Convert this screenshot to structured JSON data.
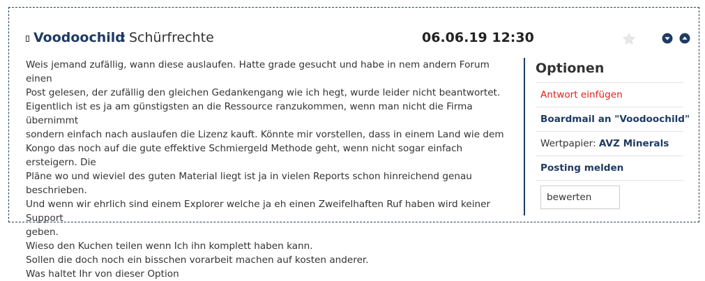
{
  "post": {
    "author": "Voodoochild",
    "separator": ":",
    "subject": "Schürfrechte",
    "datetime": "06.06.19 12:30",
    "icons": {
      "header": "document-icon",
      "favorite": "star-icon",
      "scroll_down": "chevron-down-icon",
      "scroll_up": "chevron-up-icon"
    },
    "body_lines": [
      "Weis jemand zufällig, wann diese auslaufen. Hatte grade gesucht und habe in nem andern Forum einen",
      "Post gelesen, der zufällig den gleichen Gedankengang wie ich hegt, wurde leider nicht beantwortet.",
      "Eigentlich ist es ja am günstigsten an die Ressource ranzukommen, wenn man nicht die Firma übernimmt",
      "sondern einfach nach auslaufen die Lizenz kauft. Könnte mir vorstellen, dass in einem Land wie dem",
      "Kongo das noch auf die gute effektive Schmiergeld Methode geht, wenn nicht sogar einfach ersteigern. Die",
      "Pläne wo und wieviel des guten Material liegt ist ja in vielen Reports schon hinreichend genau beschrieben.",
      "Und wenn wir ehrlich sind einem Explorer welche ja eh einen Zweifelhaften Ruf haben wird keiner Support",
      "geben.",
      "Wieso den Kuchen teilen wenn Ich ihn komplett haben kann.",
      "Sollen die doch noch ein bisschen vorarbeit machen auf kosten anderer.",
      "Was haltet Ihr von dieser Option"
    ]
  },
  "options": {
    "title": "Optionen",
    "reply": "Antwort einfügen",
    "boardmail": "Boardmail an \"Voodoochild\"",
    "security_label": "Wertpapier:",
    "security_name": "AVZ Minerals",
    "report": "Posting melden",
    "rate": "bewerten"
  },
  "colors": {
    "accent": "#1f3b63",
    "reply_red": "#e0201b",
    "text": "#333333"
  }
}
